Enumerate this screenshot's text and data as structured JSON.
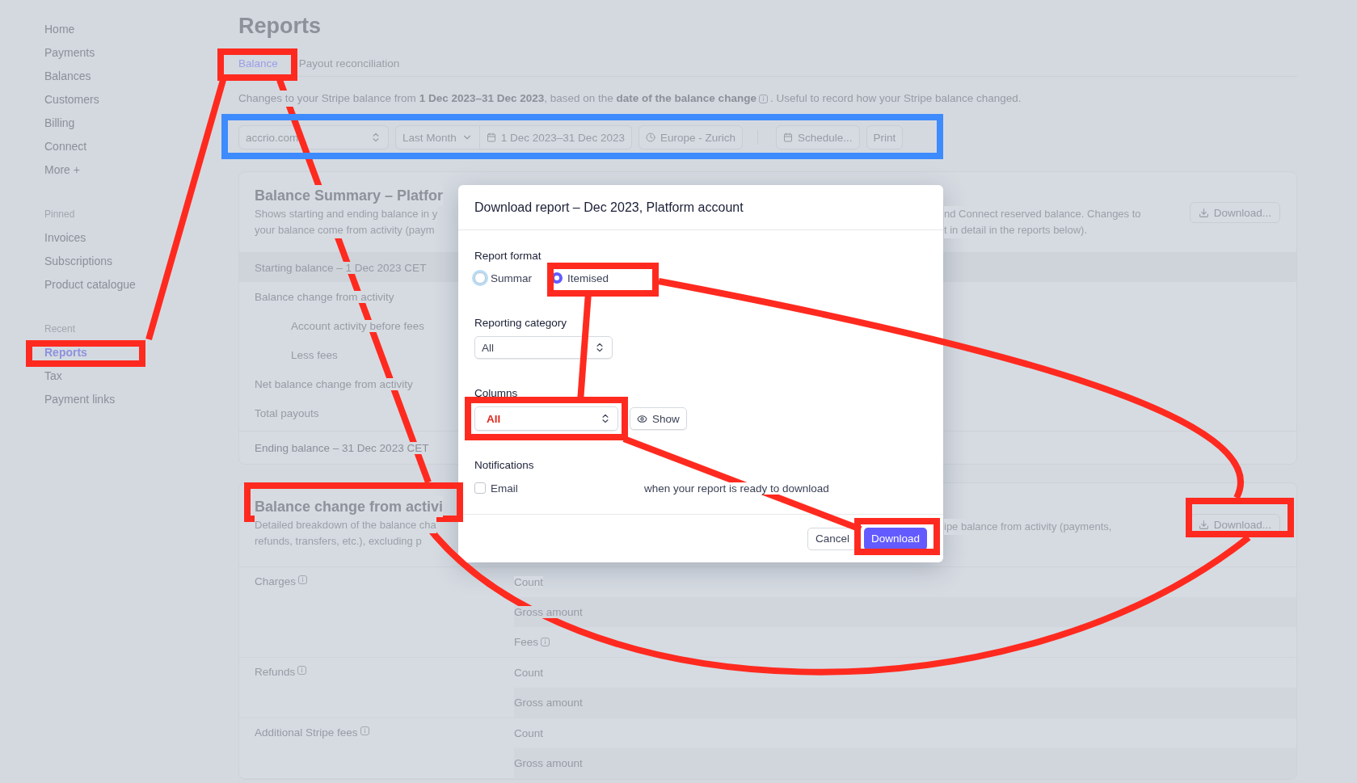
{
  "sidebar": {
    "items": [
      {
        "label": "Home",
        "selected": false
      },
      {
        "label": "Payments",
        "selected": false
      },
      {
        "label": "Balances",
        "selected": false
      },
      {
        "label": "Customers",
        "selected": false
      },
      {
        "label": "Billing",
        "selected": false
      },
      {
        "label": "Connect",
        "selected": false
      },
      {
        "label": "More +",
        "selected": false
      }
    ],
    "sections": [
      {
        "title": "Pinned",
        "items": [
          {
            "label": "Invoices",
            "selected": false
          },
          {
            "label": "Subscriptions",
            "selected": false
          },
          {
            "label": "Product catalogue",
            "selected": false
          }
        ]
      },
      {
        "title": "Recent",
        "items": [
          {
            "label": "Reports",
            "selected": true
          },
          {
            "label": "Tax",
            "selected": false
          },
          {
            "label": "Payment links",
            "selected": false
          }
        ]
      }
    ]
  },
  "page": {
    "title": "Reports",
    "tabs": [
      {
        "label": "Balance",
        "selected": true
      },
      {
        "label": "Payout reconciliation",
        "selected": false
      }
    ],
    "description": "Changes to your Stripe balance from **1 Dec 2023–31 Dec 2023**, based on the **date of the balance change**",
    "description_tail": ". Useful to record how your Stripe balance changed.",
    "toolbar": {
      "account": "accrio.com",
      "period": "Last Month",
      "date_range": "1 Dec 2023–31 Dec 2023",
      "timezone": "Europe - Zurich",
      "schedule": "Schedule...",
      "print": "Print"
    },
    "cards": [
      {
        "title": "Balance Summary – Platfor",
        "description_left": [
          "Shows starting and ending balance in y",
          "your balance come from activity (paym"
        ],
        "description_right": [
          "nd Connect reserved balance. Changes to",
          "t in detail in the reports below)."
        ],
        "download": "Download...",
        "rows": [
          {
            "label": "Starting balance – 1 Dec 2023 CET",
            "kind": "band"
          },
          {
            "label": "Balance change from activity",
            "kind": "item"
          },
          {
            "label": "Account activity before fees",
            "kind": "sub"
          },
          {
            "label": "Less fees",
            "kind": "sub"
          },
          {
            "label": "Net balance change from activity",
            "kind": "item"
          },
          {
            "label": "Total payouts",
            "kind": "item"
          },
          {
            "label": "Ending balance – 31 Dec 2023 CET",
            "kind": "total"
          }
        ]
      },
      {
        "title": "Balance change from activi",
        "description_left": [
          "Detailed breakdown of the balance cha",
          "refunds, transfers, etc.), excluding p"
        ],
        "description_right": [
          "ipe balance from activity (payments,"
        ],
        "download": "Download...",
        "groups": [
          {
            "label": "Charges",
            "info": true,
            "metrics": [
              {
                "label": "Count",
                "info": false
              },
              {
                "label": "Gross amount",
                "info": false
              },
              {
                "label": "Fees",
                "info": true
              }
            ]
          },
          {
            "label": "Refunds",
            "info": true,
            "metrics": [
              {
                "label": "Count",
                "info": false
              },
              {
                "label": "Gross amount",
                "info": false
              }
            ]
          },
          {
            "label": "Additional Stripe fees",
            "info": true,
            "metrics": [
              {
                "label": "Count",
                "info": false
              },
              {
                "label": "Gross amount",
                "info": false
              }
            ]
          }
        ]
      }
    ]
  },
  "dialog": {
    "title": "Download report – Dec 2023, Platform account",
    "format": {
      "label": "Report format",
      "options": [
        {
          "label": "Summar",
          "selected": false
        },
        {
          "label": "Itemised",
          "selected": true
        }
      ]
    },
    "category": {
      "label": "Reporting category",
      "value": "All"
    },
    "columns": {
      "label": "Columns",
      "value": "All",
      "highlighted": true,
      "show": "Show"
    },
    "notifications": {
      "label": "Notifications",
      "checkbox": {
        "label": "Email",
        "checked": false
      },
      "note": "when your report is ready to download"
    },
    "cancel": "Cancel",
    "confirm": "Download"
  }
}
